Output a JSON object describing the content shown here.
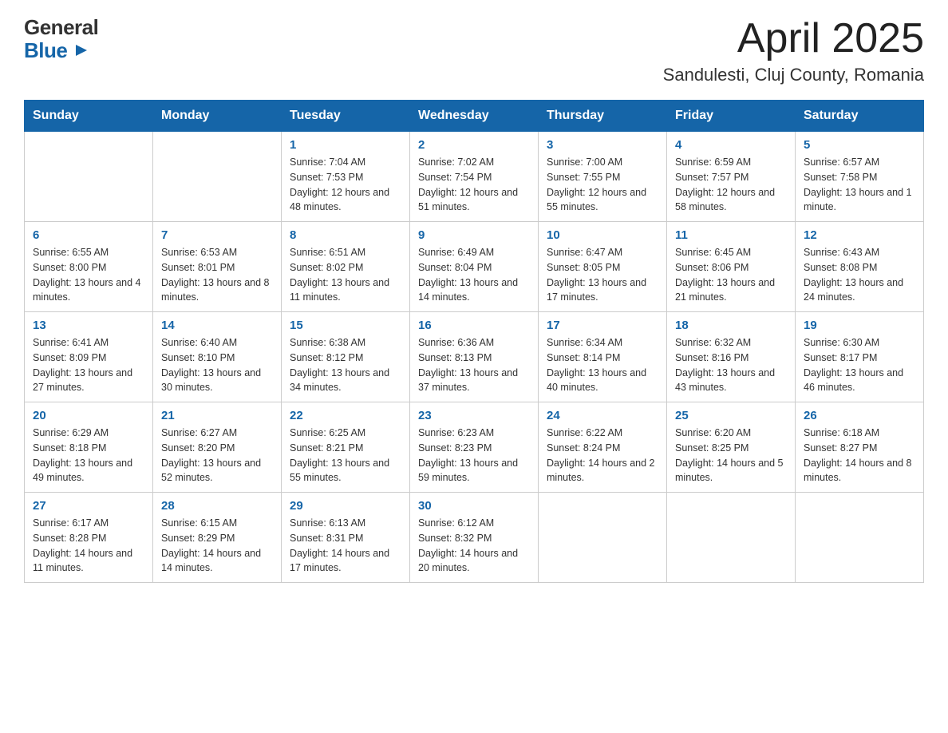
{
  "header": {
    "logo_general": "General",
    "logo_blue": "Blue",
    "month_title": "April 2025",
    "location": "Sandulеsti, Cluj County, Romania"
  },
  "calendar": {
    "days_of_week": [
      "Sunday",
      "Monday",
      "Tuesday",
      "Wednesday",
      "Thursday",
      "Friday",
      "Saturday"
    ],
    "weeks": [
      [
        {
          "day": "",
          "info": ""
        },
        {
          "day": "",
          "info": ""
        },
        {
          "day": "1",
          "info": "Sunrise: 7:04 AM\nSunset: 7:53 PM\nDaylight: 12 hours\nand 48 minutes."
        },
        {
          "day": "2",
          "info": "Sunrise: 7:02 AM\nSunset: 7:54 PM\nDaylight: 12 hours\nand 51 minutes."
        },
        {
          "day": "3",
          "info": "Sunrise: 7:00 AM\nSunset: 7:55 PM\nDaylight: 12 hours\nand 55 minutes."
        },
        {
          "day": "4",
          "info": "Sunrise: 6:59 AM\nSunset: 7:57 PM\nDaylight: 12 hours\nand 58 minutes."
        },
        {
          "day": "5",
          "info": "Sunrise: 6:57 AM\nSunset: 7:58 PM\nDaylight: 13 hours\nand 1 minute."
        }
      ],
      [
        {
          "day": "6",
          "info": "Sunrise: 6:55 AM\nSunset: 8:00 PM\nDaylight: 13 hours\nand 4 minutes."
        },
        {
          "day": "7",
          "info": "Sunrise: 6:53 AM\nSunset: 8:01 PM\nDaylight: 13 hours\nand 8 minutes."
        },
        {
          "day": "8",
          "info": "Sunrise: 6:51 AM\nSunset: 8:02 PM\nDaylight: 13 hours\nand 11 minutes."
        },
        {
          "day": "9",
          "info": "Sunrise: 6:49 AM\nSunset: 8:04 PM\nDaylight: 13 hours\nand 14 minutes."
        },
        {
          "day": "10",
          "info": "Sunrise: 6:47 AM\nSunset: 8:05 PM\nDaylight: 13 hours\nand 17 minutes."
        },
        {
          "day": "11",
          "info": "Sunrise: 6:45 AM\nSunset: 8:06 PM\nDaylight: 13 hours\nand 21 minutes."
        },
        {
          "day": "12",
          "info": "Sunrise: 6:43 AM\nSunset: 8:08 PM\nDaylight: 13 hours\nand 24 minutes."
        }
      ],
      [
        {
          "day": "13",
          "info": "Sunrise: 6:41 AM\nSunset: 8:09 PM\nDaylight: 13 hours\nand 27 minutes."
        },
        {
          "day": "14",
          "info": "Sunrise: 6:40 AM\nSunset: 8:10 PM\nDaylight: 13 hours\nand 30 minutes."
        },
        {
          "day": "15",
          "info": "Sunrise: 6:38 AM\nSunset: 8:12 PM\nDaylight: 13 hours\nand 34 minutes."
        },
        {
          "day": "16",
          "info": "Sunrise: 6:36 AM\nSunset: 8:13 PM\nDaylight: 13 hours\nand 37 minutes."
        },
        {
          "day": "17",
          "info": "Sunrise: 6:34 AM\nSunset: 8:14 PM\nDaylight: 13 hours\nand 40 minutes."
        },
        {
          "day": "18",
          "info": "Sunrise: 6:32 AM\nSunset: 8:16 PM\nDaylight: 13 hours\nand 43 minutes."
        },
        {
          "day": "19",
          "info": "Sunrise: 6:30 AM\nSunset: 8:17 PM\nDaylight: 13 hours\nand 46 minutes."
        }
      ],
      [
        {
          "day": "20",
          "info": "Sunrise: 6:29 AM\nSunset: 8:18 PM\nDaylight: 13 hours\nand 49 minutes."
        },
        {
          "day": "21",
          "info": "Sunrise: 6:27 AM\nSunset: 8:20 PM\nDaylight: 13 hours\nand 52 minutes."
        },
        {
          "day": "22",
          "info": "Sunrise: 6:25 AM\nSunset: 8:21 PM\nDaylight: 13 hours\nand 55 minutes."
        },
        {
          "day": "23",
          "info": "Sunrise: 6:23 AM\nSunset: 8:23 PM\nDaylight: 13 hours\nand 59 minutes."
        },
        {
          "day": "24",
          "info": "Sunrise: 6:22 AM\nSunset: 8:24 PM\nDaylight: 14 hours\nand 2 minutes."
        },
        {
          "day": "25",
          "info": "Sunrise: 6:20 AM\nSunset: 8:25 PM\nDaylight: 14 hours\nand 5 minutes."
        },
        {
          "day": "26",
          "info": "Sunrise: 6:18 AM\nSunset: 8:27 PM\nDaylight: 14 hours\nand 8 minutes."
        }
      ],
      [
        {
          "day": "27",
          "info": "Sunrise: 6:17 AM\nSunset: 8:28 PM\nDaylight: 14 hours\nand 11 minutes."
        },
        {
          "day": "28",
          "info": "Sunrise: 6:15 AM\nSunset: 8:29 PM\nDaylight: 14 hours\nand 14 minutes."
        },
        {
          "day": "29",
          "info": "Sunrise: 6:13 AM\nSunset: 8:31 PM\nDaylight: 14 hours\nand 17 minutes."
        },
        {
          "day": "30",
          "info": "Sunrise: 6:12 AM\nSunset: 8:32 PM\nDaylight: 14 hours\nand 20 minutes."
        },
        {
          "day": "",
          "info": ""
        },
        {
          "day": "",
          "info": ""
        },
        {
          "day": "",
          "info": ""
        }
      ]
    ]
  }
}
